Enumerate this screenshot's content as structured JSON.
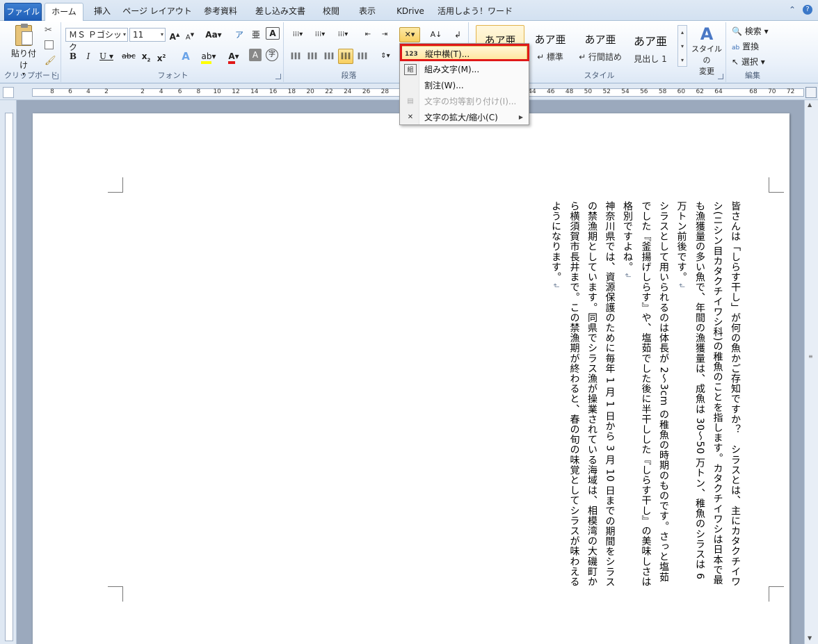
{
  "tabs": [
    "ファイル",
    "ホーム",
    "挿入",
    "ページ レイアウト",
    "参考資料",
    "差し込み文書",
    "校閲",
    "表示",
    "KDrive",
    "活用しよう！ワード"
  ],
  "ribbon": {
    "clipboard": {
      "paste_label": "貼り付け",
      "group": "クリップボード"
    },
    "font": {
      "group": "フォント",
      "font_name": "ＭＳ Ｐゴシック",
      "font_size": "11"
    },
    "paragraph": {
      "group": "段落"
    },
    "styles": {
      "group": "スタイル",
      "items": [
        {
          "sample": "あア亜",
          "name": ""
        },
        {
          "sample": "あア亜",
          "name": "↵ 標準"
        },
        {
          "sample": "あア亜",
          "name": "↵ 行間詰め"
        },
        {
          "sample": "あア亜",
          "name": "見出し 1"
        }
      ],
      "change_label_1": "スタイルの",
      "change_label_2": "変更"
    },
    "editing": {
      "group": "編集",
      "search": "検索",
      "replace": "置換",
      "select": "選択"
    }
  },
  "ruler_numbers_left": [
    "8",
    "6",
    "4",
    "2"
  ],
  "ruler_numbers_right": [
    "2",
    "4",
    "6",
    "8",
    "10",
    "12",
    "14",
    "16",
    "18",
    "20",
    "22",
    "24",
    "26",
    "28",
    "44",
    "46",
    "48",
    "50",
    "52",
    "54",
    "56",
    "58",
    "60",
    "62",
    "64",
    "68",
    "70",
    "72"
  ],
  "menu": {
    "items": [
      {
        "label": "縦中横(T)...",
        "icon": "tate-chu-yoko-icon",
        "glyph": "123",
        "disabled": false,
        "highlight": true
      },
      {
        "label": "組み文字(M)...",
        "icon": "kumimoji-icon",
        "glyph": "組",
        "disabled": false,
        "highlight": false
      },
      {
        "label": "割注(W)...",
        "icon": "warichu-icon",
        "glyph": "",
        "disabled": false,
        "highlight": false
      },
      {
        "label": "文字の均等割り付け(I)...",
        "icon": "distribute-icon",
        "glyph": "▤",
        "disabled": true,
        "highlight": false
      },
      {
        "label": "文字の拡大/縮小(C)",
        "icon": "scale-icon",
        "glyph": "✕",
        "disabled": false,
        "highlight": false
      }
    ]
  },
  "document": {
    "paragraphs": [
      "皆さんは「しらす干し」が何の魚かご存知ですか？　シラスとは、主にカタクチイワシ(ニシン目カタクチイワシ科)の稚魚のことを指します。カタクチイワシは日本で最も漁獲量の多い魚で、年間の漁獲量は、成魚は 30～50 万トン、稚魚のシラスは 6 万トン前後です。",
      "シラスとして用いられるのは体長が 2～3cm の稚魚の時期のものです。さっと塩茹でした『釜揚げしらす』や、塩茹でした後に半干しした『しらす干し』の美味しさは格別ですよね。",
      "神奈川県では、資源保護のために毎年 1 月 1 日から 3 月 10 日までの期間をシラスの禁漁期としています。同県でシラス漁が操業されている海域は、相模湾の大磯町から横須賀市長井まで。この禁漁期が終わると、春の旬の味覚としてシラスが味わえるようになります。"
    ]
  }
}
